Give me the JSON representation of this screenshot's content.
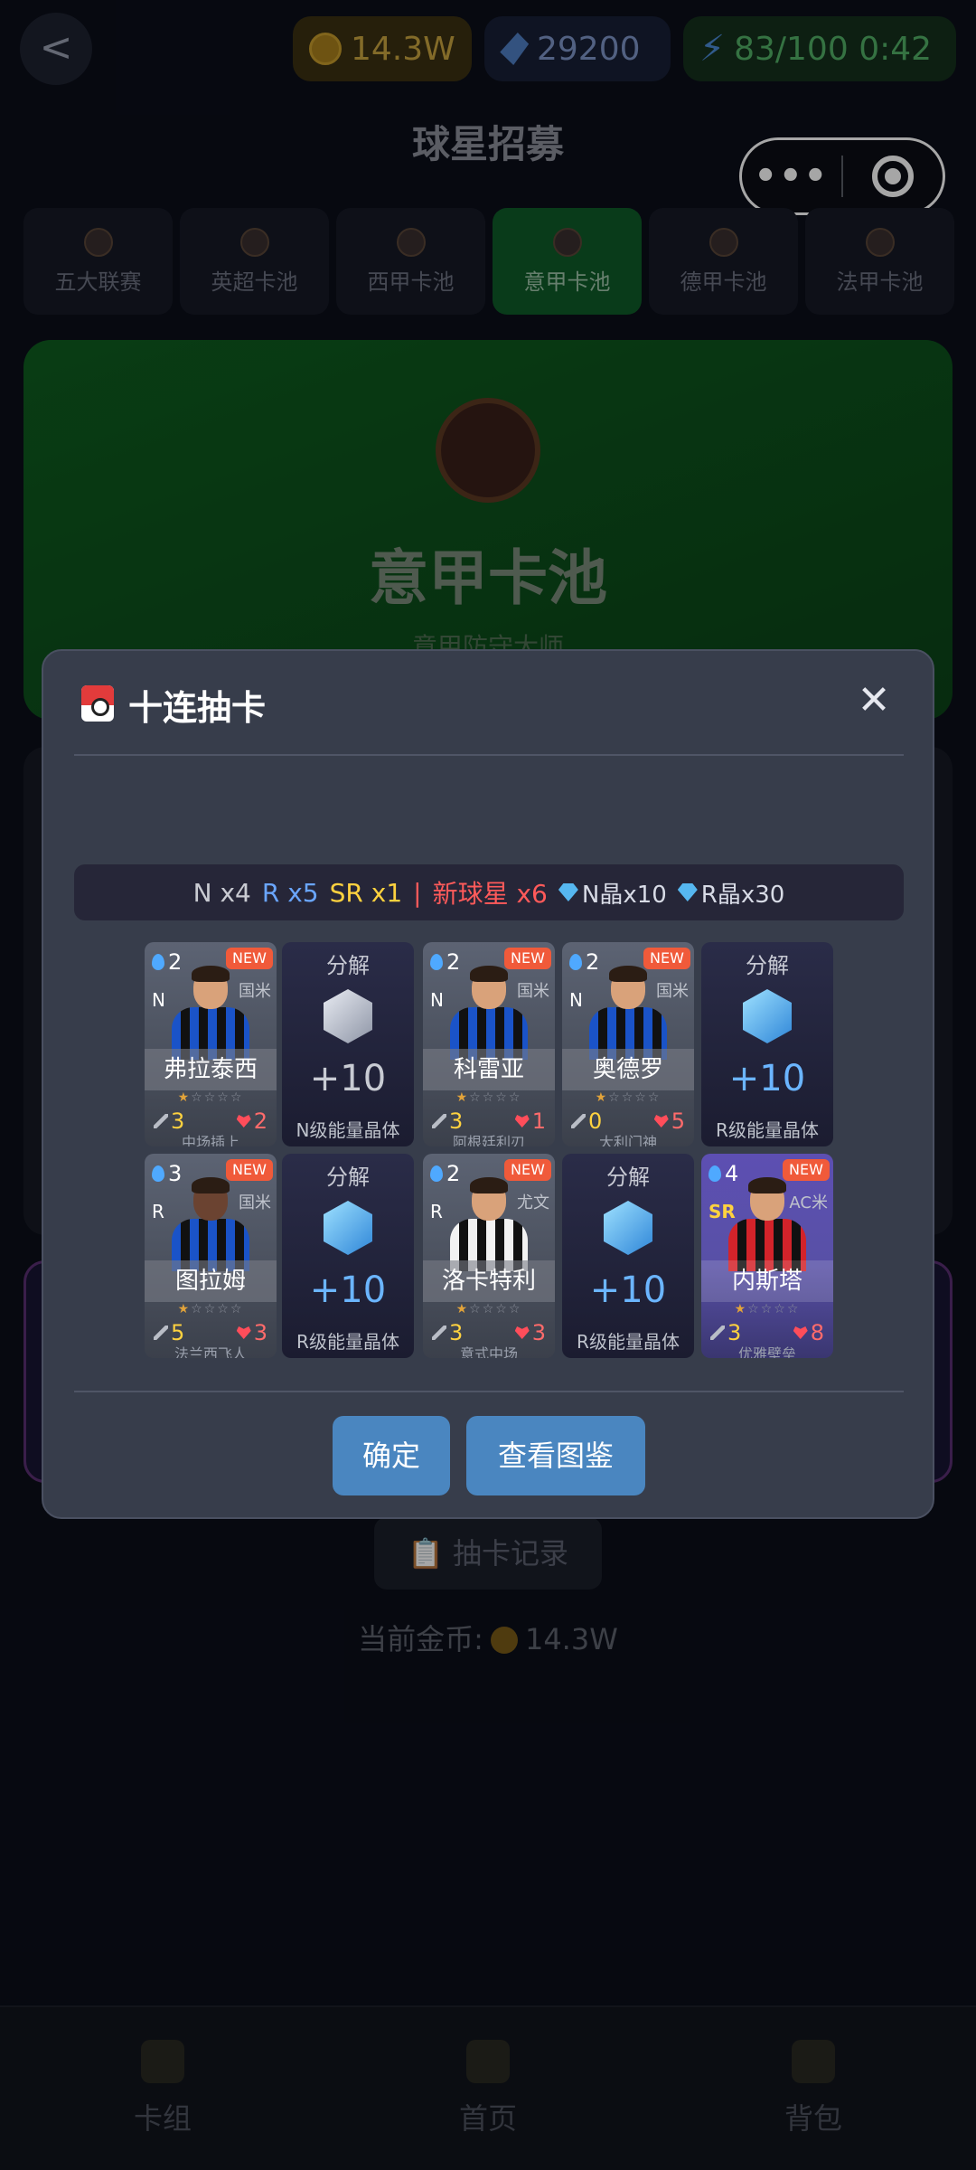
{
  "topbar": {
    "back_icon": "chevron-left-icon",
    "back_label": "<",
    "coins": "14.3W",
    "gems": "29200",
    "energy": "83/100 0:42"
  },
  "page_title": "球星招募",
  "capsule": {
    "more_label": "•••"
  },
  "pool_tabs": [
    {
      "label": "五大联赛"
    },
    {
      "label": "英超卡池"
    },
    {
      "label": "西甲卡池"
    },
    {
      "label": "意甲卡池",
      "active": true
    },
    {
      "label": "德甲卡池"
    },
    {
      "label": "法甲卡池"
    }
  ],
  "banner": {
    "title": "意甲卡池",
    "subtitle": "意甲防守大师"
  },
  "record_button": "📋 抽卡记录",
  "current_coins": {
    "label": "当前金币:",
    "value": "14.3W"
  },
  "bottom_nav": [
    {
      "label": "卡组"
    },
    {
      "label": "首页"
    },
    {
      "label": "背包"
    }
  ],
  "modal": {
    "title": "十连抽卡",
    "close_label": "✕",
    "summary": {
      "n": "N x4",
      "r": "R x5",
      "sr": "SR x1",
      "bar": "|",
      "new": "新球星 x6",
      "n_crystal": "N晶x10",
      "r_crystal": "R晶x30"
    },
    "cards": [
      {
        "kind": "player",
        "cost": "2",
        "new": "NEW",
        "rarity": "N",
        "club": "国米",
        "name": "弗拉泰西",
        "atk": "3",
        "hp": "2",
        "role": "中场插上"
      },
      {
        "kind": "decomp",
        "label": "分解",
        "amount": "+10",
        "crystal": "N级能量晶体"
      },
      {
        "kind": "player",
        "cost": "2",
        "new": "NEW",
        "rarity": "N",
        "club": "国米",
        "name": "科雷亚",
        "atk": "3",
        "hp": "1",
        "role": "阿根廷利刃"
      },
      {
        "kind": "player",
        "cost": "2",
        "new": "NEW",
        "rarity": "N",
        "club": "国米",
        "name": "奥德罗",
        "atk": "0",
        "hp": "5",
        "role": "大利门神"
      },
      {
        "kind": "decomp",
        "label": "分解",
        "amount": "+10",
        "crystal": "R级能量晶体"
      },
      {
        "kind": "player",
        "cost": "3",
        "new": "NEW",
        "rarity": "R",
        "club": "国米",
        "name": "图拉姆",
        "atk": "5",
        "hp": "3",
        "role": "法兰西飞人"
      },
      {
        "kind": "decomp",
        "label": "分解",
        "amount": "+10",
        "crystal": "R级能量晶体"
      },
      {
        "kind": "player",
        "cost": "2",
        "new": "NEW",
        "rarity": "R",
        "club": "尤文",
        "name": "洛卡特利",
        "atk": "3",
        "hp": "3",
        "role": "意式中场"
      },
      {
        "kind": "decomp",
        "label": "分解",
        "amount": "+10",
        "crystal": "R级能量晶体"
      },
      {
        "kind": "player",
        "cost": "4",
        "new": "NEW",
        "rarity": "SR",
        "club": "AC米",
        "name": "内斯塔",
        "atk": "3",
        "hp": "8",
        "role": "优雅壁垒"
      }
    ],
    "ok_label": "确定",
    "view_label": "查看图鉴"
  },
  "colors": {
    "accent_button": "#4a86c0",
    "new_badge": "#f05a3a",
    "r_rarity": "#6aa6ff",
    "sr_rarity": "#ffd23f",
    "new_text": "#ff5a5a"
  }
}
